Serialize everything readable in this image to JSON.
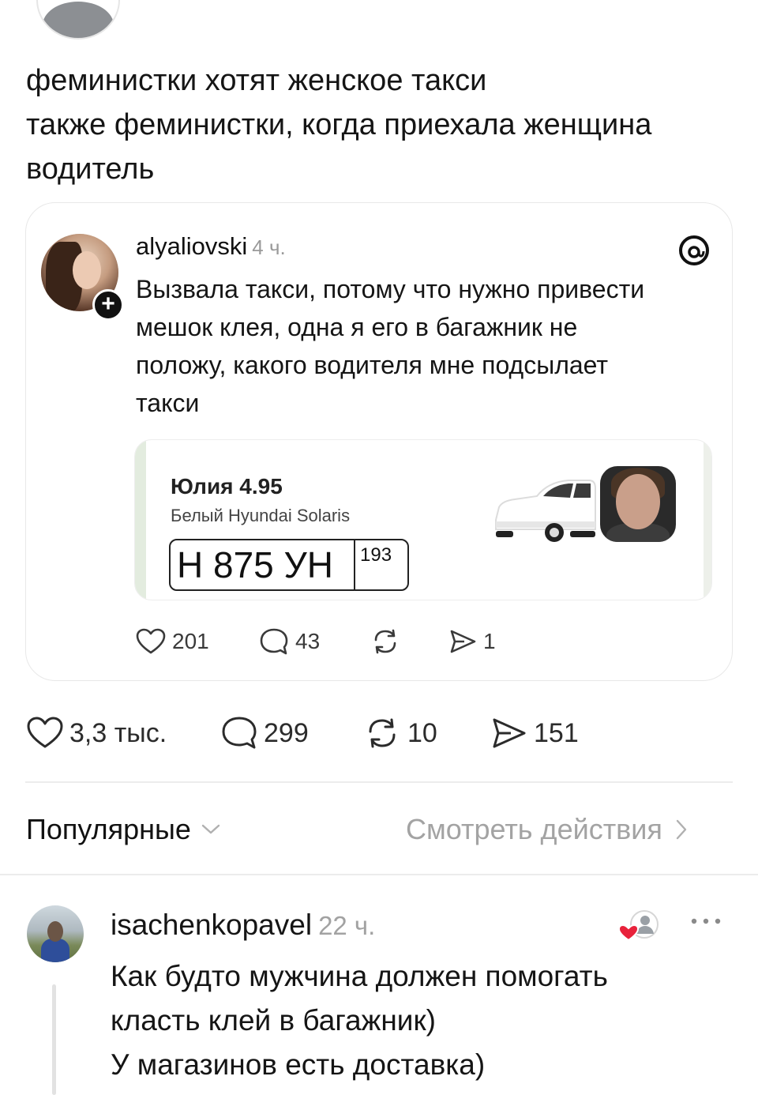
{
  "post": {
    "lines": [
      "феминистки хотят женское такси",
      "также феминистки, когда приехала женщина",
      "водитель"
    ]
  },
  "quote": {
    "username": "alyaliovski",
    "time": "4 ч.",
    "text_lines": [
      "Вызвала такси, потому что нужно привести",
      "мешок клея, одна я его в багажник не",
      "положу, какого водителя мне подсылает",
      "такси"
    ],
    "taxi_card": {
      "driver": "Юлия 4.95",
      "car": "Белый Hyundai Solaris",
      "plate_number": "Н 875 УН",
      "plate_region": "193"
    },
    "actions": {
      "likes": "201",
      "comments": "43",
      "shares": "1"
    }
  },
  "post_actions": {
    "likes": "3,3 тыс.",
    "comments": "299",
    "reposts": "10",
    "shares": "151"
  },
  "comments_header": {
    "sort_label": "Популярные",
    "activity_link": "Смотреть действия"
  },
  "comment": {
    "username": "isachenkopavel",
    "time": "22 ч.",
    "text_lines": [
      "Как будто мужчина должен помогать",
      "класть клей в багажник)",
      "У магазинов есть доставка)"
    ]
  },
  "colors": {
    "text": "#151515",
    "muted": "#a3a3a3",
    "heart_red": "#e8223b",
    "divider": "#ececec"
  }
}
